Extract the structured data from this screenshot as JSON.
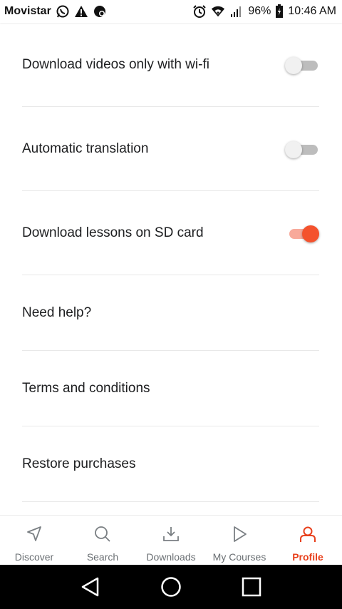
{
  "status_bar": {
    "carrier": "Movistar",
    "battery": "96%",
    "time": "10:46 AM",
    "icons": [
      "whatsapp-icon",
      "warning-icon",
      "app-notification-icon",
      "alarm-icon",
      "wifi-icon",
      "signal-icon",
      "battery-icon"
    ]
  },
  "settings": [
    {
      "label": "Download videos only with wi-fi",
      "toggle": true,
      "on": false
    },
    {
      "label": "Automatic translation",
      "toggle": true,
      "on": false
    },
    {
      "label": "Download lessons on SD card",
      "toggle": true,
      "on": true
    },
    {
      "label": "Need help?",
      "toggle": false
    },
    {
      "label": "Terms and conditions",
      "toggle": false
    },
    {
      "label": "Restore purchases",
      "toggle": false
    }
  ],
  "bottom_nav": [
    {
      "label": "Discover",
      "icon": "navigation-arrow-icon",
      "active": false
    },
    {
      "label": "Search",
      "icon": "search-icon",
      "active": false
    },
    {
      "label": "Downloads",
      "icon": "download-icon",
      "active": false
    },
    {
      "label": "My Courses",
      "icon": "play-icon",
      "active": false
    },
    {
      "label": "Profile",
      "icon": "profile-icon",
      "active": true
    }
  ],
  "colors": {
    "accent": "#e8401c",
    "toggle_on_knob": "#f4522d",
    "toggle_on_track": "#f8a99a",
    "toggle_off_track": "#bdbdbd",
    "text": "#1c1d1f",
    "nav_inactive": "#6a6f73"
  },
  "system_nav": {
    "icons": [
      "back-icon",
      "home-icon",
      "recents-icon"
    ]
  }
}
